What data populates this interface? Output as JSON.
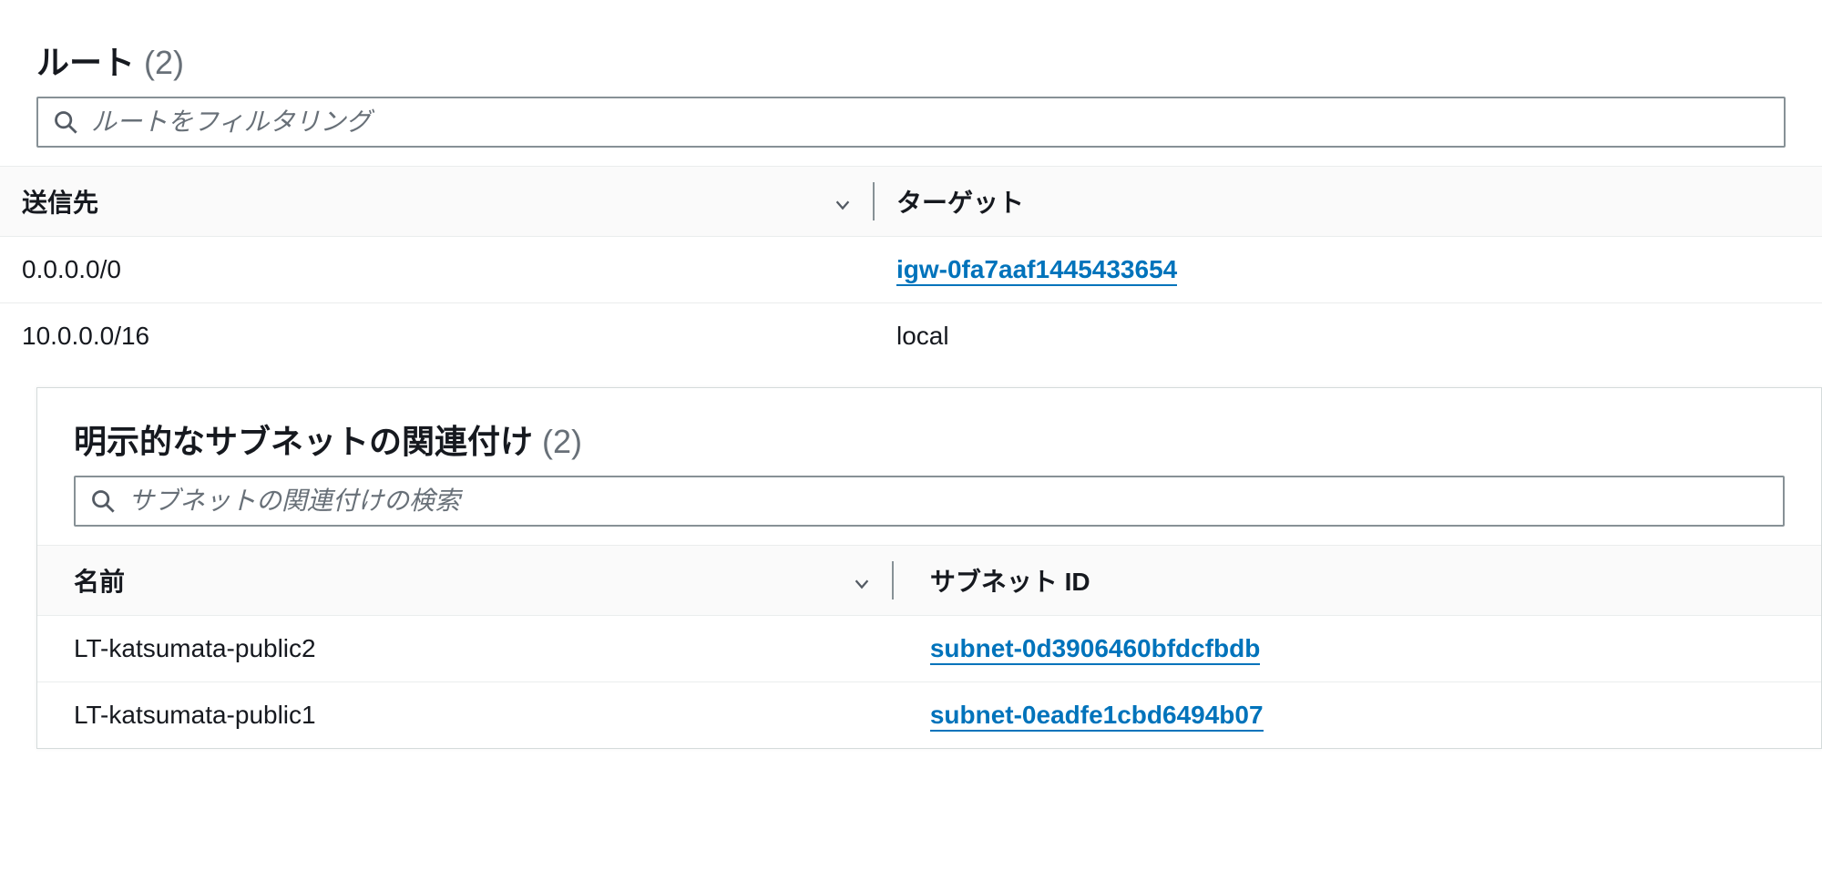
{
  "routes": {
    "title": "ルート",
    "count": "(2)",
    "search_placeholder": "ルートをフィルタリング",
    "columns": {
      "destination": "送信先",
      "target": "ターゲット"
    },
    "rows": [
      {
        "destination": "0.0.0.0/0",
        "target": "igw-0fa7aaf1445433654",
        "is_link": true
      },
      {
        "destination": "10.0.0.0/16",
        "target": "local",
        "is_link": false
      }
    ]
  },
  "subnets": {
    "title": "明示的なサブネットの関連付け",
    "count": "(2)",
    "search_placeholder": "サブネットの関連付けの検索",
    "columns": {
      "name": "名前",
      "subnet_id": "サブネット ID"
    },
    "rows": [
      {
        "name": "LT-katsumata-public2",
        "subnet_id": "subnet-0d3906460bfdcfbdb"
      },
      {
        "name": "LT-katsumata-public1",
        "subnet_id": "subnet-0eadfe1cbd6494b07"
      }
    ]
  }
}
